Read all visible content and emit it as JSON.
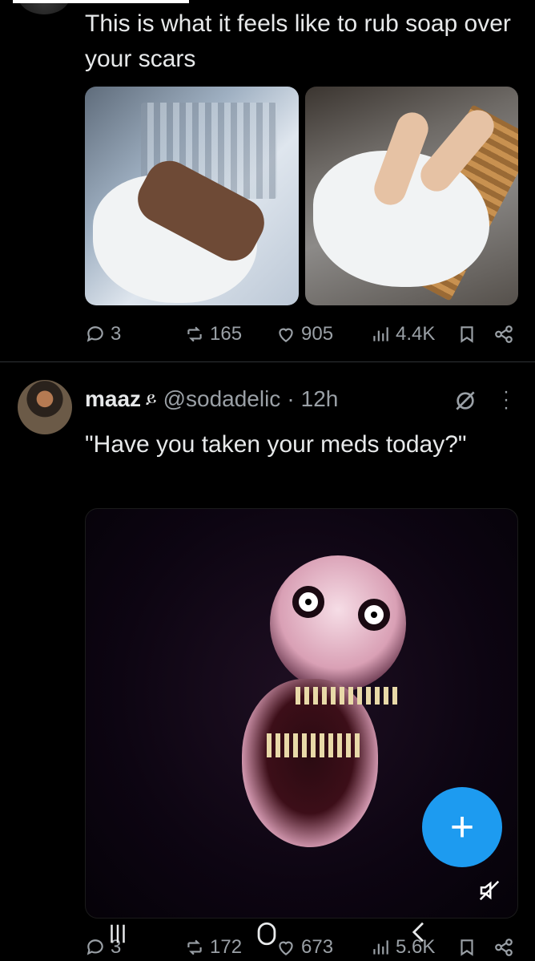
{
  "tweet1": {
    "text": "This is what it feels like to rub soap over your scars",
    "actions": {
      "replies": "3",
      "reposts": "165",
      "likes": "905",
      "views": "4.4K"
    }
  },
  "tweet2": {
    "author_name": "maaz",
    "badge": "ይ",
    "handle": "@sodadelic",
    "separator": "·",
    "time": "12h",
    "text": "\"Have you taken your meds today?\"",
    "actions": {
      "replies": "3",
      "reposts": "172",
      "likes": "673",
      "views": "5.6K"
    }
  },
  "fab": {
    "label": "+"
  },
  "colors": {
    "background": "#000000",
    "text": "#e7e9ea",
    "muted": "#9aa0a6",
    "accent": "#1d9bf0",
    "divider": "#2f3336"
  },
  "icons": [
    "reply-icon",
    "repost-icon",
    "like-icon",
    "views-icon",
    "bookmark-icon",
    "share-icon",
    "grok-icon",
    "more-icon",
    "mute-icon",
    "compose-icon",
    "nav-recents-icon",
    "nav-home-icon",
    "nav-back-icon"
  ]
}
